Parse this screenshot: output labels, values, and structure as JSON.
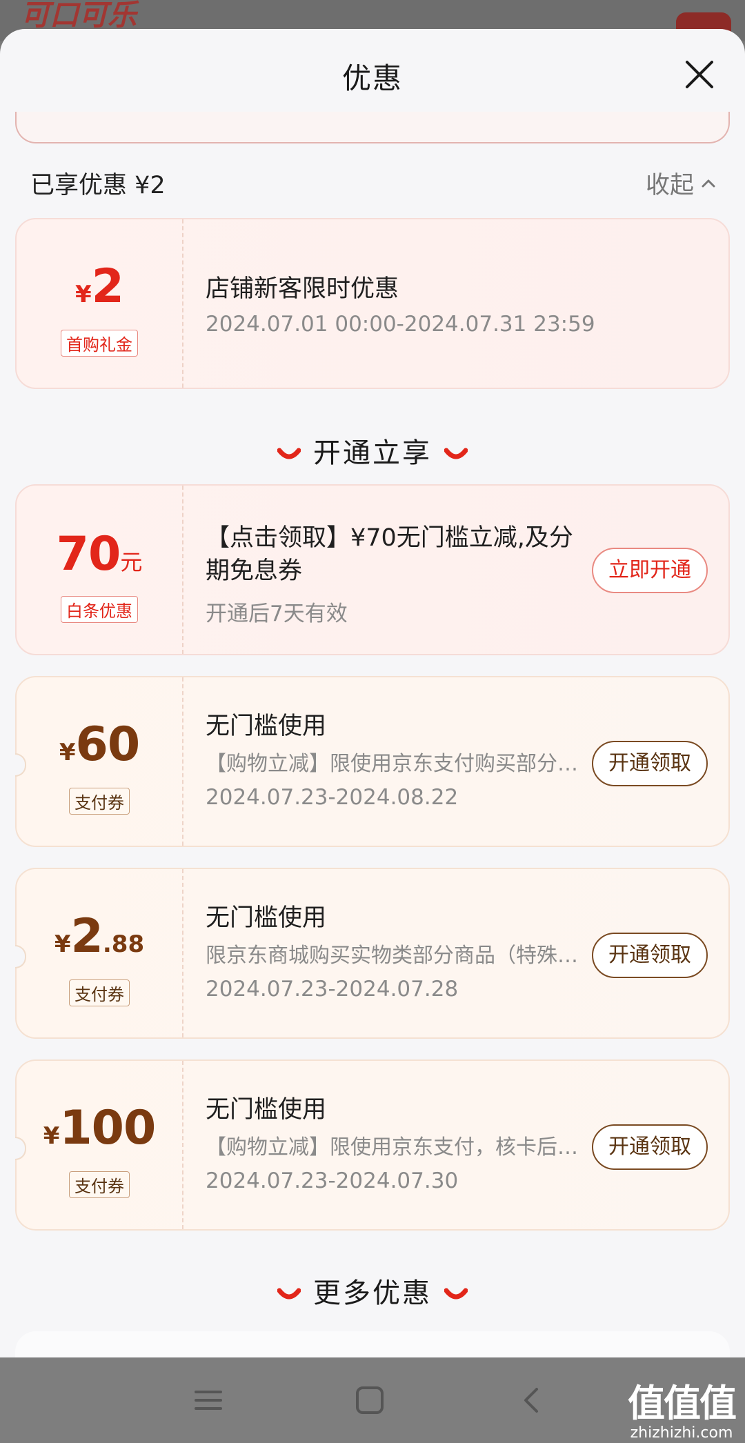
{
  "background": {
    "logo_text": "可口可乐"
  },
  "sheet": {
    "title": "优惠",
    "enjoyed_label": "已享优惠 ¥2",
    "collapse_label": "收起"
  },
  "applied_coupon": {
    "currency": "¥",
    "amount": "2",
    "tag": "首购礼金",
    "title": "店铺新客限时优惠",
    "date": "2024.07.01 00:00-2024.07.31 23:59"
  },
  "section_open": "开通立享",
  "baitiao_coupon": {
    "amount": "70",
    "unit": "元",
    "tag": "白条优惠",
    "title": "【点击领取】¥70无门槛立减,及分期免息券",
    "validity": "开通后7天有效",
    "button": "立即开通"
  },
  "pay_coupons": [
    {
      "currency": "¥",
      "amount": "60",
      "decimal": "",
      "tag": "支付券",
      "title": "无门槛使用",
      "desc": "【购物立减】限使用京东支付购买部分商品",
      "date": "2024.07.23-2024.08.22",
      "button": "开通领取"
    },
    {
      "currency": "¥",
      "amount": "2",
      "decimal": ".88",
      "tag": "支付券",
      "title": "无门槛使用",
      "desc": "限京东商城购买实物类部分商品（特殊商品除外）",
      "date": "2024.07.23-2024.07.28",
      "button": "开通领取"
    },
    {
      "currency": "¥",
      "amount": "100",
      "decimal": "",
      "tag": "支付券",
      "title": "无门槛使用",
      "desc": "【购物立减】限使用京东支付，核卡后可用",
      "date": "2024.07.23-2024.07.30",
      "button": "开通领取"
    }
  ],
  "section_more": "更多优惠",
  "watermark": {
    "main": "值值值",
    "sub": "zhizhizhi.com"
  },
  "colors": {
    "accent_red": "#e2261a",
    "gold_brown": "#7a3a10"
  },
  "icons": [
    "close-icon",
    "chevron-up-icon",
    "smile-icon",
    "menu-icon",
    "home-icon",
    "back-icon"
  ]
}
